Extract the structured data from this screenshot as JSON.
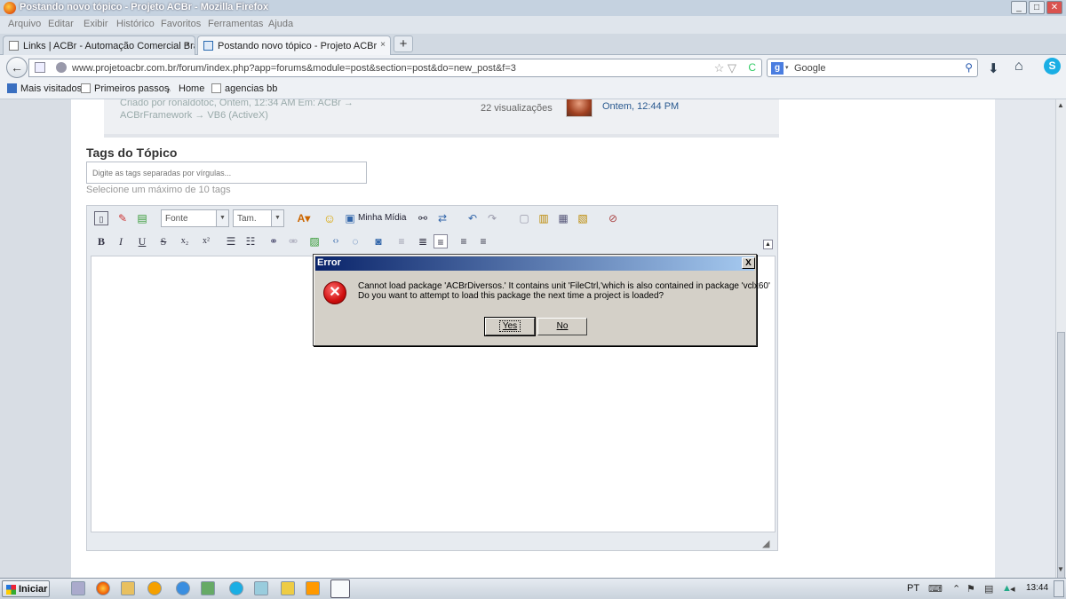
{
  "window": {
    "title": "Postando novo tópico - Projeto ACBr - Mozilla Firefox",
    "min_label": "_",
    "max_label": "□",
    "close_label": "✕"
  },
  "menu": [
    "Arquivo",
    "Editar",
    "Exibir",
    "Histórico",
    "Favoritos",
    "Ferramentas",
    "Ajuda"
  ],
  "tabs": [
    {
      "label": "Links | ACBr - Automação Comercial Brasil",
      "close": "×"
    },
    {
      "label": "Postando novo tópico - Projeto ACBr",
      "close": "×"
    }
  ],
  "newtab_label": "+",
  "nav": {
    "back": "←",
    "url": "www.projetoacbr.com.br/forum/index.php?app=forums&module=post&section=post&do=new_post&f=3",
    "star": "☆ ▽",
    "reload": "C",
    "search_engine": "g",
    "search_placeholder": "Google",
    "search_icon": "⚲"
  },
  "bookmarks": [
    "Mais visitados",
    "Primeiros passos",
    "Home",
    "agencias bb"
  ],
  "topic": {
    "meta1": "Criado por ronaldotoc, Ontem, 12:34 AM Em: ACBr →",
    "meta2": "ACBrFramework → VB6 (ActiveX)",
    "views": "22 visualizações",
    "last_post": "Ontem, 12:44 PM"
  },
  "tags": {
    "title": "Tags do Tópico",
    "placeholder": "Digite as tags separadas por vírgulas...",
    "hint": "Selecione um máximo de 10 tags"
  },
  "editor": {
    "font_select": "Fonte",
    "size_select": "Tam.",
    "media_label": "Minha Mídia",
    "bold": "B",
    "italic": "I",
    "underline": "U",
    "strike": "S",
    "subscript": "x₂",
    "superscript": "x²"
  },
  "dialog": {
    "title": "Error",
    "close": "X",
    "icon": "✕",
    "message_line1": "Cannot load package 'ACBrDiversos.'  It contains unit 'FileCtrl,'which is also contained in package 'vclx60'",
    "message_line2": "Do you want to attempt to load this package the next time a project is loaded?",
    "yes": "Yes",
    "no": "No"
  },
  "taskbar": {
    "start": "Iniciar",
    "language": "PT",
    "clock": "13:44"
  }
}
